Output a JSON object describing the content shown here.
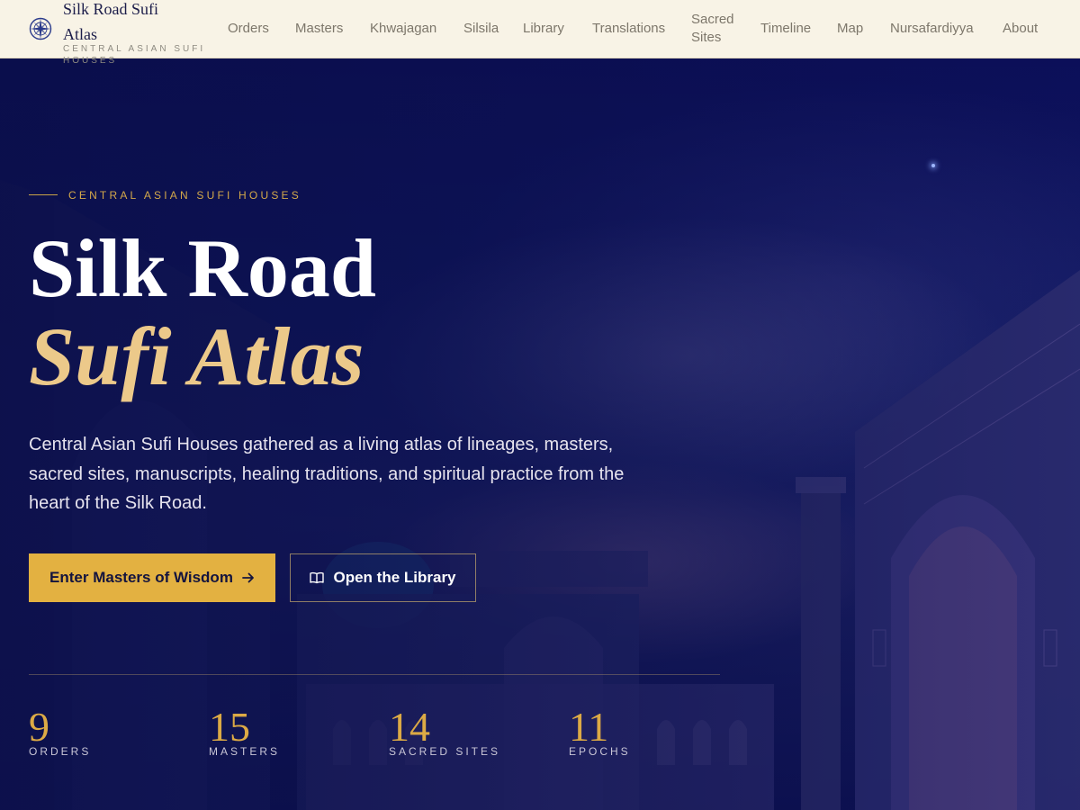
{
  "brand": {
    "title": "Silk Road Sufi Atlas",
    "subtitle": "CENTRAL ASIAN SUFI HOUSES",
    "icon": "compass-rose-icon"
  },
  "nav": {
    "orders": "Orders",
    "masters": "Masters",
    "khwajagan": "Khwajagan",
    "silsila": "Silsila",
    "library": "Library",
    "translations": "Translations",
    "sacred_sites": "Sacred Sites",
    "timeline": "Timeline",
    "map": "Map",
    "nursafardiyya": "Nursafardiyya",
    "about": "About"
  },
  "hero": {
    "eyebrow": "CENTRAL ASIAN SUFI HOUSES",
    "title_line1": "Silk Road",
    "title_line2": "Sufi Atlas",
    "description": "Central Asian Sufi Houses gathered as a living atlas of lineages, masters, sacred sites, manuscripts, healing traditions, and spiritual practice from the heart of the Silk Road.",
    "primary_cta": "Enter Masters of Wisdom",
    "primary_cta_icon": "arrow-right-icon",
    "secondary_cta": "Open the Library",
    "secondary_cta_icon": "open-book-icon"
  },
  "stats": [
    {
      "value": "9",
      "label": "ORDERS"
    },
    {
      "value": "15",
      "label": "MASTERS"
    },
    {
      "value": "14",
      "label": "SACRED SITES"
    },
    {
      "value": "11",
      "label": "EPOCHS"
    }
  ],
  "colors": {
    "nav_bg": "#f8f3e6",
    "hero_bg": "#0c1050",
    "accent_gold": "#e3b141",
    "title_gold": "#ecc98a",
    "stat_gold": "#dcaa45"
  }
}
